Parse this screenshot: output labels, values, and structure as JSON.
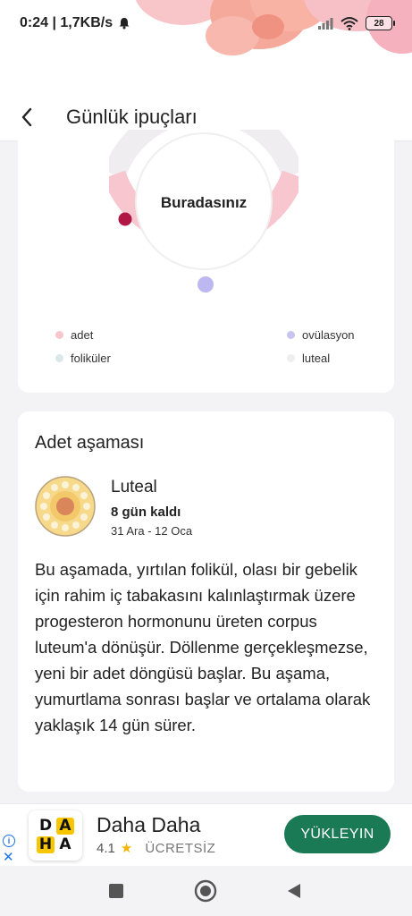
{
  "status_bar": {
    "time_speed": "0:24 | 1,7KB/s",
    "battery": "28"
  },
  "header": {
    "title": "Günlük ipuçları"
  },
  "cycle": {
    "center_label": "Buradasınız",
    "legend": [
      {
        "label": "adet",
        "color": "#f7c6cf"
      },
      {
        "label": "ovülasyon",
        "color": "#c8c4f2"
      },
      {
        "label": "foliküler",
        "color": "#dbe8ea"
      },
      {
        "label": "luteal",
        "color": "#eeeef0"
      }
    ],
    "colors": {
      "ring": "#f7c6cf",
      "ring_light": "#efedef",
      "marker": "#b01745",
      "ovulation": "#bdb8f2"
    }
  },
  "phase": {
    "section_title": "Adet aşaması",
    "name": "Luteal",
    "days_left": "8 gün kaldı",
    "date_range": "31 Ara - 12 Oca",
    "description": "Bu aşamada, yırtılan folikül, olası bir gebelik için rahim iç tabakasını kalınlaştırmak üzere progesteron hormonunu üreten corpus luteum'a dönüşür. Döllenme gerçekleşmezse, yeni bir adet döngüsü başlar. Bu aşama, yumurtlama sonrası başlar ve ortalama olarak yaklaşık 14 gün sürer."
  },
  "ad": {
    "app_name": "Daha Daha",
    "logo_letters": [
      "D",
      "A",
      "H",
      "A"
    ],
    "rating": "4.1",
    "price": "ÜCRETSİZ",
    "cta": "YÜKLEYIN",
    "accent": "#1a7a56"
  }
}
